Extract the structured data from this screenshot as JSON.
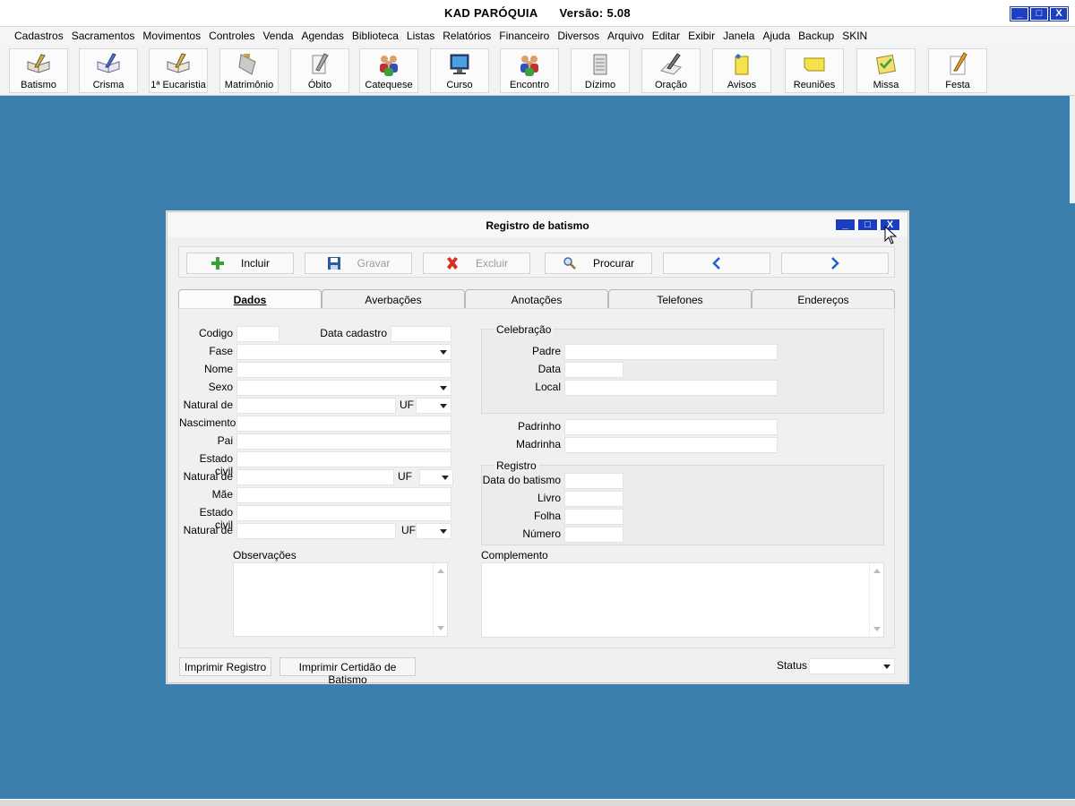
{
  "app": {
    "name": "KAD PARÓQUIA",
    "version": "Versão: 5.08",
    "window_buttons": {
      "minimize": "_",
      "maximize": "□",
      "close": "X"
    }
  },
  "menu": [
    "Cadastros",
    "Sacramentos",
    "Movimentos",
    "Controles",
    "Venda",
    "Agendas",
    "Biblioteca",
    "Listas",
    "Relatórios",
    "Financeiro",
    "Diversos",
    "Arquivo",
    "Editar",
    "Exibir",
    "Janela",
    "Ajuda",
    "Backup",
    "SKIN"
  ],
  "toolbar": [
    {
      "label": "Batismo",
      "icon": "book-pen-icon"
    },
    {
      "label": "Crisma",
      "icon": "book-pen-icon"
    },
    {
      "label": "1ª Eucaristia",
      "icon": "book-pen-icon"
    },
    {
      "label": "Matrimônio",
      "icon": "rings-icon"
    },
    {
      "label": "Óbito",
      "icon": "notepad-icon"
    },
    {
      "label": "Catequese",
      "icon": "people-icon"
    },
    {
      "label": "Curso",
      "icon": "monitor-icon"
    },
    {
      "label": "Encontro",
      "icon": "people-icon"
    },
    {
      "label": "Dízimo",
      "icon": "stack-icon"
    },
    {
      "label": "Oração",
      "icon": "pen-paper-icon"
    },
    {
      "label": "Avisos",
      "icon": "note-pin-icon"
    },
    {
      "label": "Reuniões",
      "icon": "sticky-note-icon"
    },
    {
      "label": "Missa",
      "icon": "checklist-icon"
    },
    {
      "label": "Festa",
      "icon": "pencil-paper-icon"
    }
  ],
  "dialog": {
    "title": "Registro de batismo",
    "actions": {
      "incluir": "Incluir",
      "gravar": "Gravar",
      "excluir": "Excluir",
      "procurar": "Procurar"
    },
    "tabs": [
      "Dados",
      "Averbações",
      "Anotações",
      "Telefones",
      "Endereços"
    ],
    "active_tab": "Dados",
    "fields_left": {
      "codigo": "Codigo",
      "data_cadastro": "Data cadastro",
      "fase": "Fase",
      "nome": "Nome",
      "sexo": "Sexo",
      "natural_de": "Natural de",
      "uf": "UF",
      "nascimento": "Nascimento",
      "pai": "Pai",
      "estado_civil": "Estado civil",
      "mae": "Mãe",
      "observacoes": "Observações"
    },
    "celebracao": {
      "title": "Celebração",
      "padre": "Padre",
      "data": "Data",
      "local": "Local"
    },
    "padrinho": "Padrinho",
    "madrinha": "Madrinha",
    "registro": {
      "title": "Registro",
      "data_batismo": "Data do batismo",
      "livro": "Livro",
      "folha": "Folha",
      "numero": "Número"
    },
    "complemento": "Complemento",
    "footer": {
      "imprimir_registro": "Imprimir Registro",
      "imprimir_certidao": "Imprimir Certidão de Batismo",
      "status": "Status"
    }
  }
}
